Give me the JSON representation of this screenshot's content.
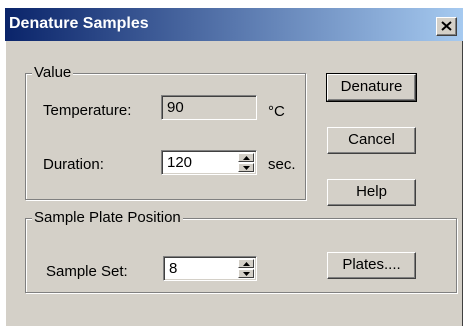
{
  "dialog": {
    "title": "Denature Samples",
    "close_glyph": "✕"
  },
  "value_group": {
    "legend": "Value",
    "temperature": {
      "label": "Temperature:",
      "value": "90",
      "unit": "°C"
    },
    "duration": {
      "label": "Duration:",
      "value": "120",
      "unit": "sec."
    }
  },
  "plate_group": {
    "legend": "Sample Plate Position",
    "sample_set": {
      "label": "Sample Set:",
      "value": "8"
    }
  },
  "buttons": {
    "denature": "Denature",
    "cancel": "Cancel",
    "help": "Help",
    "plates": "Plates...."
  },
  "colors": {
    "face": "#d4d0c8",
    "title_gradient_start": "#0a246a",
    "title_gradient_end": "#a6caf0"
  }
}
